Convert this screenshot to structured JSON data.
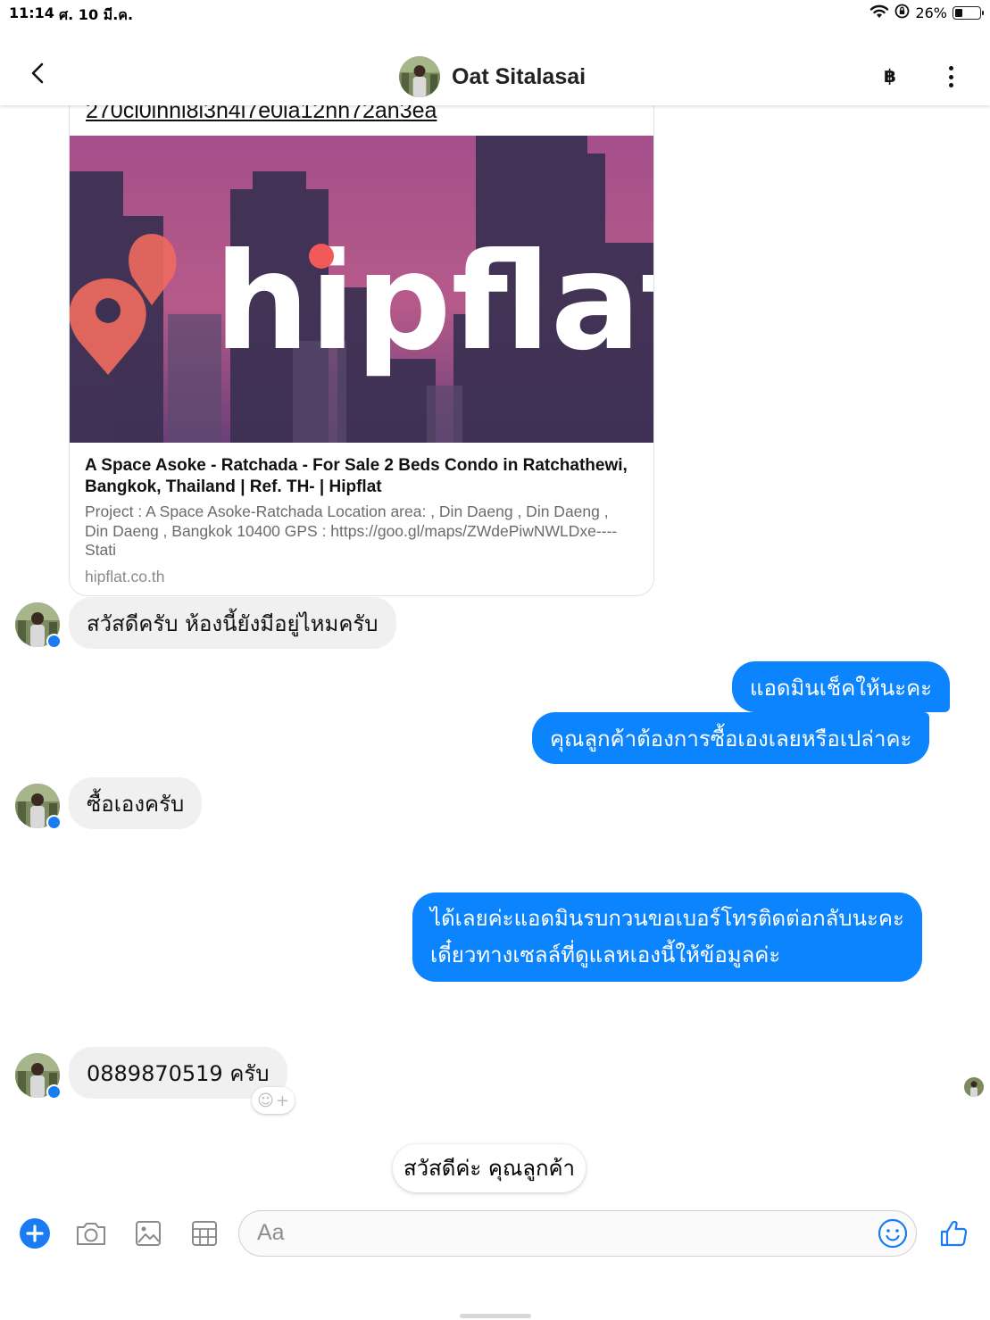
{
  "status_bar": {
    "time": "11:14",
    "date": "ศ. 10 มี.ค.",
    "battery": "26%"
  },
  "header": {
    "contact_name": "Oat Sitalasai",
    "baht_symbol": "฿"
  },
  "link_preview": {
    "url_text": "270cl0ihni8i3n4i7e0ia12nh72an3ea",
    "brand_text": "hipflat",
    "title": "A Space Asoke - Ratchada - For Sale 2 Beds Condo in Ratchathewi, Bangkok, Thailand | Ref. TH- | Hipflat",
    "description": "Project : A Space Asoke-Ratchada Location area: , Din Daeng , Din Daeng , Din Daeng , Bangkok 10400 GPS : https://goo.gl/maps/ZWdePiwNWLDxe---- Stati",
    "domain": "hipflat.co.th"
  },
  "messages": {
    "m1": "สวัสดีครับ ห้องนี้ยังมีอยู่ไหมครับ",
    "m2": "แอดมินเช็คให้นะคะ",
    "m3": "คุณลูกค้าต้องการซื้อเองเลยหรือเปล่าคะ",
    "m4": "ซื้อเองครับ",
    "m5_line1": "ได้เลยค่ะแอดมินรบกวนขอเบอร์โทรติดต่อกลับนะคะ",
    "m5_line2": "เดี๋ยวทางเซลล์ที่ดูแลหเองนี้ให้ข้อมูลค่ะ",
    "m6": "0889870519 ครับ"
  },
  "suggestion": "สวัสดีค่ะ คุณลูกค้า",
  "composer": {
    "placeholder": "Aa"
  },
  "colors": {
    "outgoing_bubble": "#0b84fe",
    "incoming_bubble": "#f0f0f0",
    "accent": "#1a7cf3",
    "brand_pin": "#ff6b6b"
  },
  "icons": {
    "back": "chevron-left-icon",
    "more": "more-vertical-icon",
    "add": "plus-circle-icon",
    "camera": "camera-icon",
    "gallery": "image-icon",
    "sticker": "grid-icon",
    "emoji": "smiley-icon",
    "like": "thumbs-up-icon"
  }
}
